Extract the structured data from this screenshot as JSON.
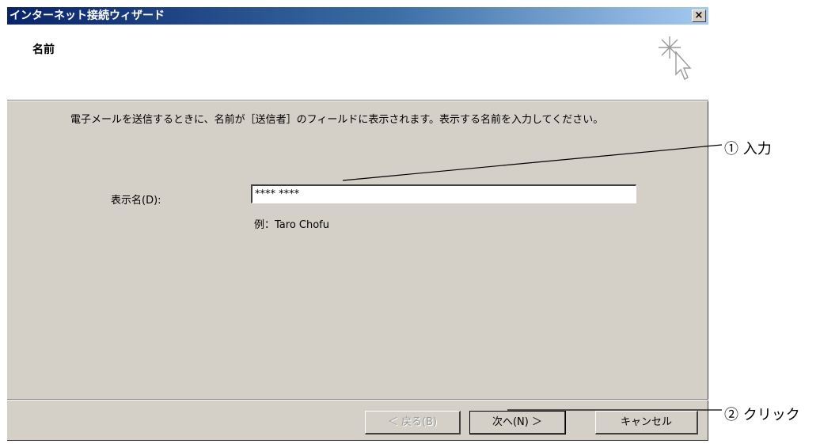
{
  "window": {
    "title": "インターネット接続ウィザード",
    "close_label": "×"
  },
  "header": {
    "title": "名前",
    "icon": "wizard-sparkle-cursor-icon"
  },
  "body": {
    "description": "電子メールを送信するときに、名前が［送信者］のフィールドに表示されます。表示する名前を入力してください。",
    "display_name_label": "表示名(D):",
    "display_name_value": "**** ****",
    "example": "例：Taro Chofu"
  },
  "buttons": {
    "back": "＜ 戻る(B)",
    "next": "次へ(N) ＞",
    "cancel": "キャンセル"
  },
  "annotations": {
    "step1": "① 入力",
    "step2": "② クリック"
  }
}
